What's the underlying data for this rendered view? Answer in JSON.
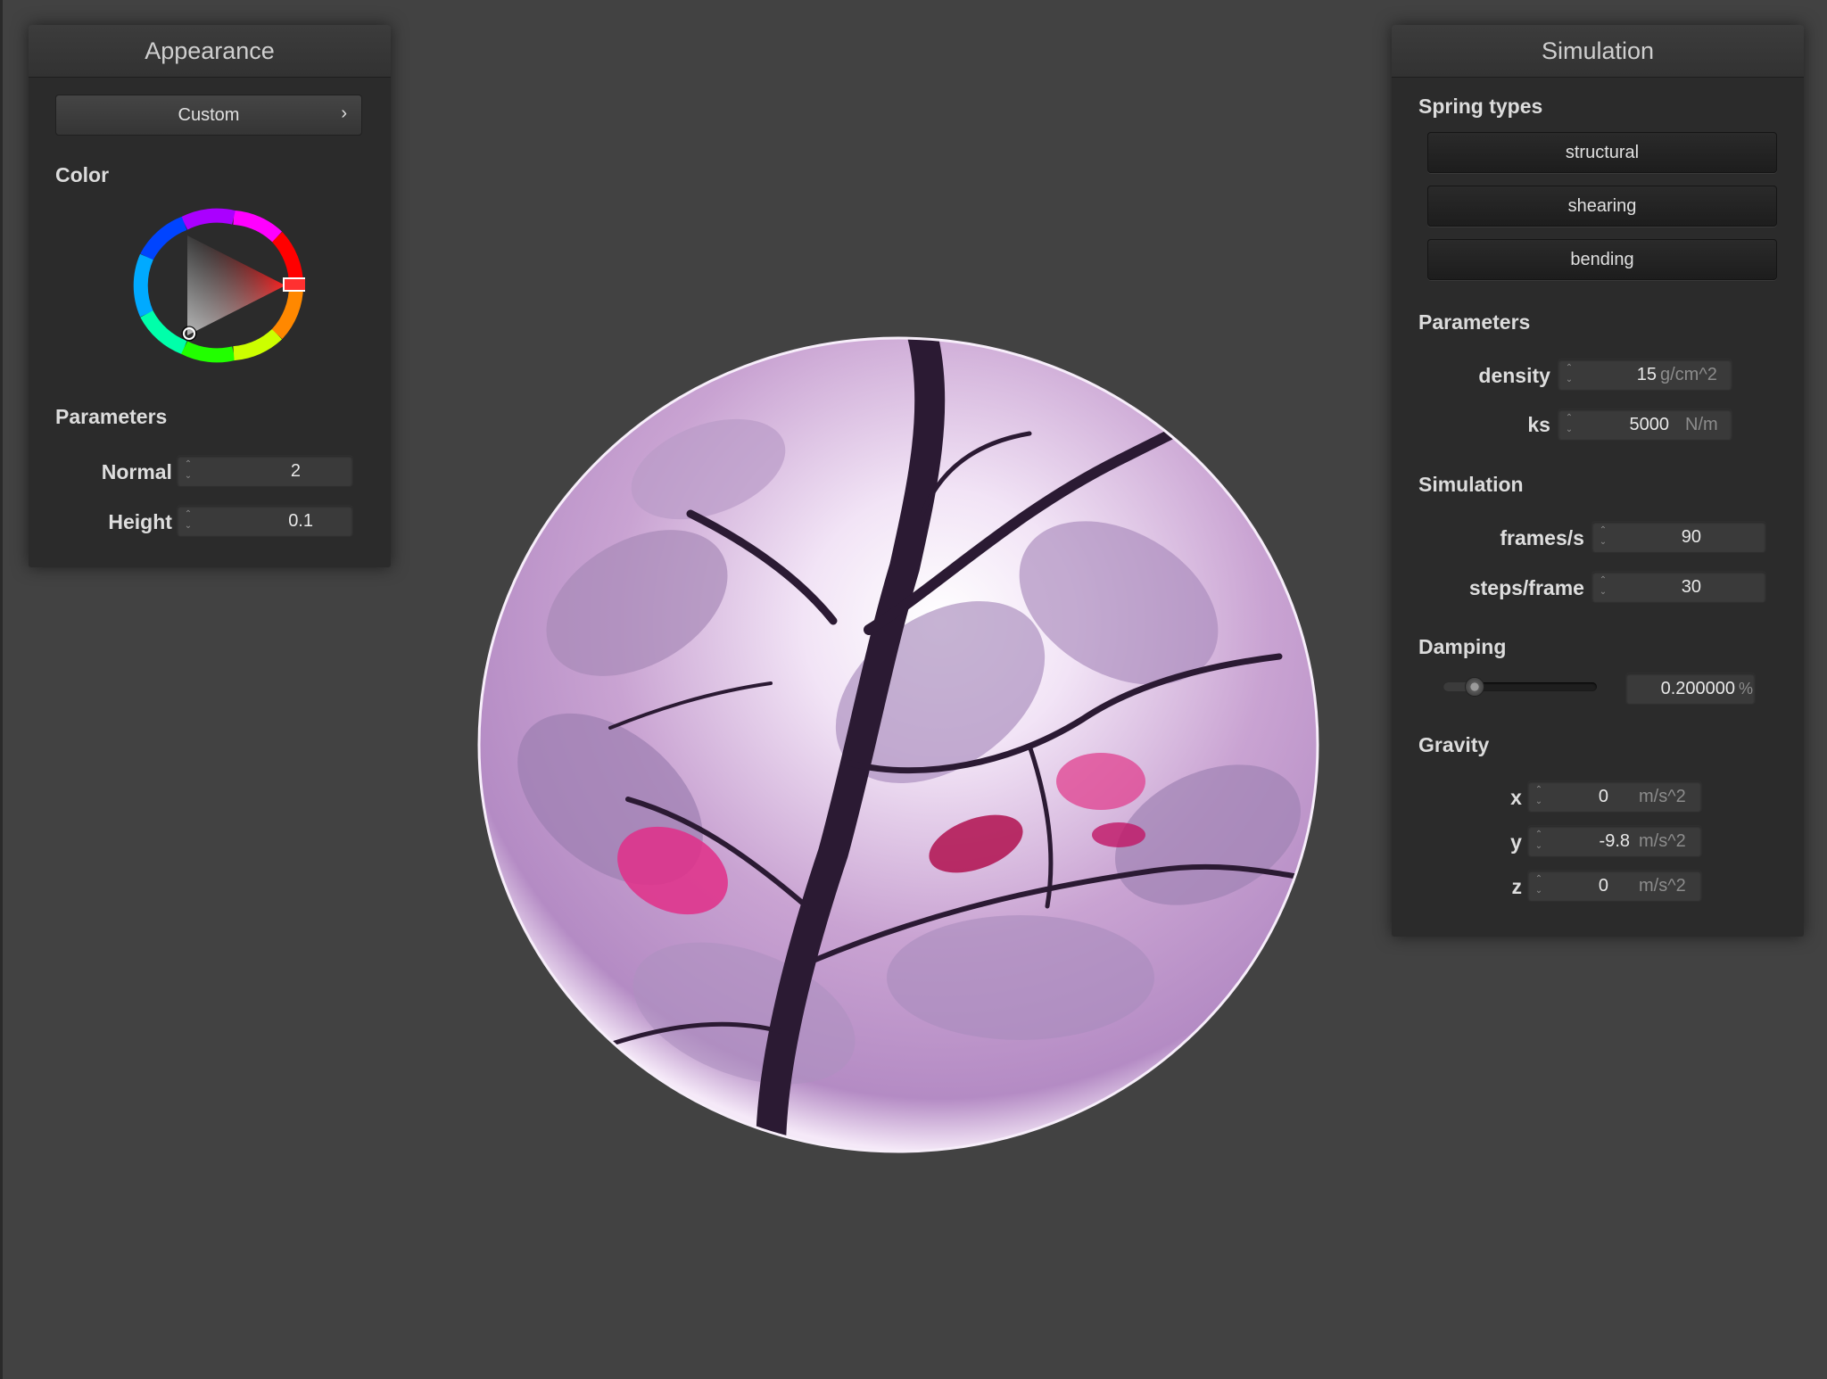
{
  "appearance": {
    "title": "Appearance",
    "preset_label": "Custom",
    "color_label": "Color",
    "parameters_label": "Parameters",
    "normal_label": "Normal :",
    "normal_value": "2",
    "height_label": "Height :",
    "height_value": "0.1"
  },
  "simulation": {
    "title": "Simulation",
    "spring_types_label": "Spring types",
    "spring_buttons": [
      "structural",
      "shearing",
      "bending"
    ],
    "parameters_label": "Parameters",
    "density_label": "density :",
    "density_value": "15",
    "density_unit": "g/cm^2",
    "ks_label": "ks :",
    "ks_value": "5000",
    "ks_unit": "N/m",
    "simulation_label": "Simulation",
    "fps_label": "frames/s :",
    "fps_value": "90",
    "steps_label": "steps/frame :",
    "steps_value": "30",
    "damping_label": "Damping",
    "damping_value": "0.200000",
    "damping_unit": "%",
    "gravity_label": "Gravity",
    "gx_label": "x :",
    "gx_value": "0",
    "gy_label": "y :",
    "gy_value": "-9.8",
    "gz_label": "z :",
    "gz_value": "0",
    "gravity_unit": "m/s^2"
  },
  "colors": {
    "background": "#424242",
    "panel": "#2b2b2b",
    "selected_color": "#ff0000"
  },
  "icons": {
    "preset_chevron": "chevron-right-icon",
    "spinner": "spinner-arrows-icon"
  }
}
